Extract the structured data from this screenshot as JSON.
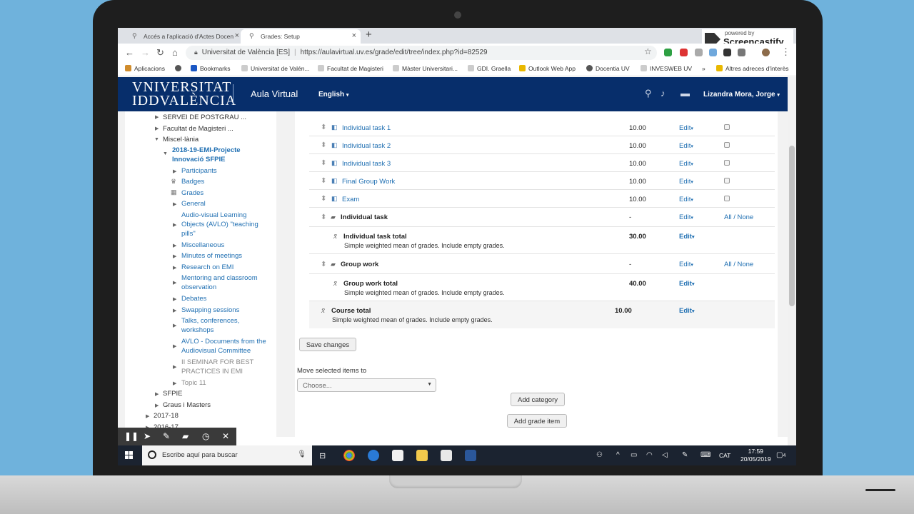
{
  "browser": {
    "tabs": [
      {
        "title": "Accés a l'aplicació d'Actes Docen",
        "active": false
      },
      {
        "title": "Grades: Setup",
        "active": true
      }
    ],
    "address": {
      "site": "Universitat de València [ES]",
      "url": "https://aulavirtual.uv.es/grade/edit/tree/index.php?id=82529"
    },
    "bookmarks": [
      "Aplicacions",
      "Bookmarks",
      "Universitat de Valén...",
      "Facultat de Magisteri",
      "Màster Universitari...",
      "GDI. Graella",
      "Outlook Web App",
      "Docentia UV",
      "INVESWEB UV",
      "»",
      "Altres adreces d'interès"
    ]
  },
  "screencastify": {
    "powered": "powered by",
    "name": "Screencastify"
  },
  "header": {
    "univ_line1": "VNIVERSITAT",
    "univ_line2": "DVALÈNCIA",
    "univ_prefix": "ID",
    "site_name": "Aula Virtual",
    "language": "English",
    "user": "Lizandra Mora, Jorge"
  },
  "nav": {
    "items": [
      {
        "label": "SERVEI DE POSTGRAU ...",
        "style": "plain"
      },
      {
        "label": "Facultat de Magisteri ...",
        "style": "plain"
      },
      {
        "label": "Miscel·lània",
        "style": "plain"
      },
      {
        "label": "2018-19-EMI-Projecte",
        "style": "bold"
      },
      {
        "label": "Innovació SFPIE",
        "style": "bold"
      },
      {
        "label": "Participants",
        "style": "link"
      },
      {
        "label": "Badges",
        "style": "link"
      },
      {
        "label": "Grades",
        "style": "link"
      },
      {
        "label": "General",
        "style": "link"
      },
      {
        "label": "Audio-visual Learning",
        "style": "link"
      },
      {
        "label": "Objects (AVLO) \"teaching",
        "style": "link"
      },
      {
        "label": "pills\"",
        "style": "link"
      },
      {
        "label": "Miscellaneous",
        "style": "link"
      },
      {
        "label": "Minutes of meetings",
        "style": "link"
      },
      {
        "label": "Research on EMI",
        "style": "link"
      },
      {
        "label": "Mentoring and classroom",
        "style": "link"
      },
      {
        "label": "observation",
        "style": "link"
      },
      {
        "label": "Debates",
        "style": "link"
      },
      {
        "label": "Swapping sessions",
        "style": "link"
      },
      {
        "label": "Talks, conferences,",
        "style": "link"
      },
      {
        "label": "workshops",
        "style": "link"
      },
      {
        "label": "AVLO - Documents from the",
        "style": "link"
      },
      {
        "label": "Audiovisual Committee",
        "style": "link"
      },
      {
        "label": "II SEMINAR FOR BEST",
        "style": "dim"
      },
      {
        "label": "PRACTICES IN EMI",
        "style": "dim"
      },
      {
        "label": "Topic 11",
        "style": "dim"
      },
      {
        "label": "SFPIE",
        "style": "plain"
      },
      {
        "label": "Graus i Masters",
        "style": "plain"
      },
      {
        "label": "2017-18",
        "style": "plain"
      },
      {
        "label": "2016-17",
        "style": "plain"
      }
    ]
  },
  "grades": {
    "rows": [
      {
        "name": "Individual task 1",
        "value": "10.00",
        "edit": "Edit",
        "kind": "item"
      },
      {
        "name": "Individual task 2",
        "value": "10.00",
        "edit": "Edit",
        "kind": "item"
      },
      {
        "name": "Individual task 3",
        "value": "10.00",
        "edit": "Edit",
        "kind": "item"
      },
      {
        "name": "Final Group Work",
        "value": "10.00",
        "edit": "Edit",
        "kind": "item"
      },
      {
        "name": "Exam",
        "value": "10.00",
        "edit": "Edit",
        "kind": "item"
      },
      {
        "name": "Individual task",
        "value": "-",
        "edit": "Edit",
        "kind": "category",
        "select": "All / None"
      },
      {
        "name": "Individual task total",
        "value": "30.00",
        "edit": "Edit",
        "kind": "total",
        "desc": "Simple weighted mean of grades. Include empty grades."
      },
      {
        "name": "Group work",
        "value": "-",
        "edit": "Edit",
        "kind": "category",
        "select": "All / None"
      },
      {
        "name": "Group work total",
        "value": "40.00",
        "edit": "Edit",
        "kind": "total",
        "desc": "Simple weighted mean of grades. Include empty grades."
      },
      {
        "name": "Course total",
        "value": "10.00",
        "edit": "Edit",
        "kind": "course",
        "desc": "Simple weighted mean of grades. Include empty grades."
      }
    ],
    "save_label": "Save changes",
    "move_label": "Move selected items to",
    "move_placeholder": "Choose...",
    "add_category": "Add category",
    "add_grade_item": "Add grade item"
  },
  "taskbar": {
    "search_placeholder": "Escribe aquí para buscar",
    "lang": "CAT",
    "time": "17:59",
    "date": "20/05/2019",
    "notifications": "4"
  }
}
